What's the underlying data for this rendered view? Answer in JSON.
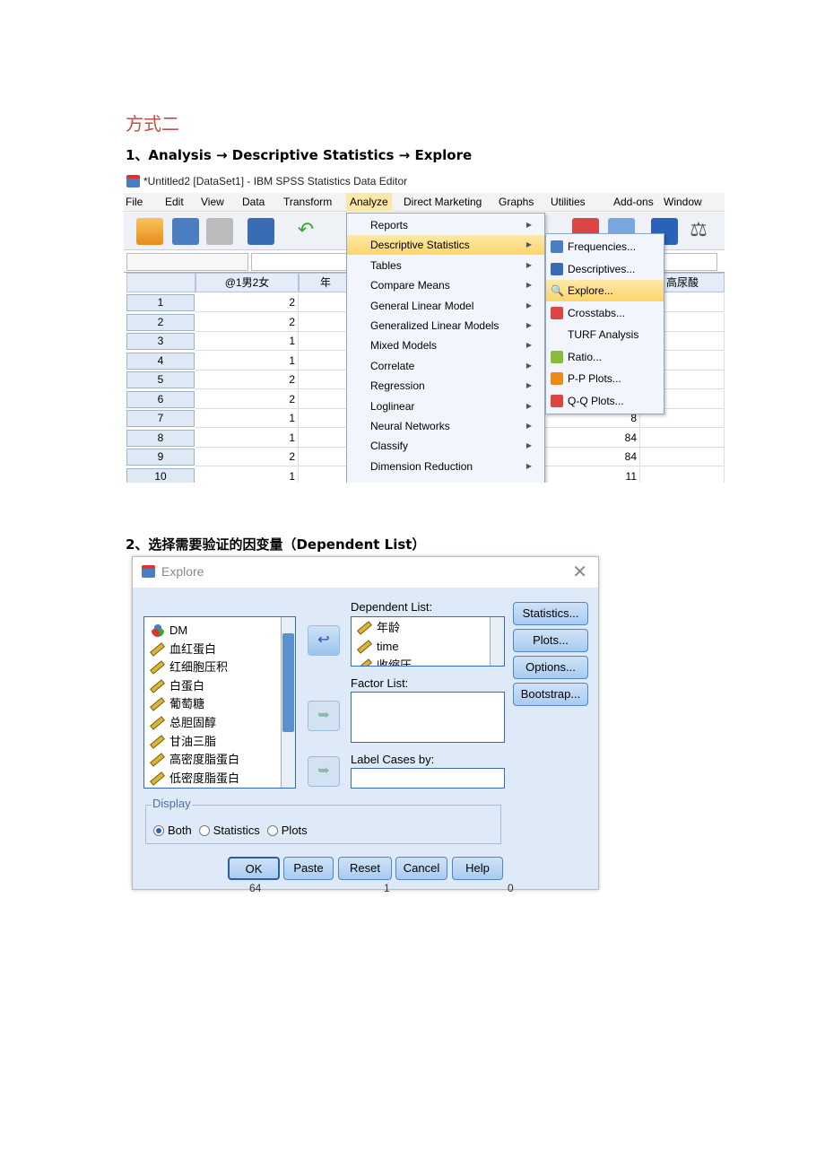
{
  "heading": "方式二",
  "step1": "1、Analysis → Descriptive Statistics → Explore",
  "step2": "2、选择需要验证的因变量（Dependent List）",
  "spss": {
    "title": "*Untitled2 [DataSet1] - IBM SPSS Statistics Data Editor",
    "menubar": [
      "File",
      "Edit",
      "View",
      "Data",
      "Transform",
      "Analyze",
      "Direct Marketing",
      "Graphs",
      "Utilities",
      "Add-ons",
      "Window"
    ],
    "active_menu": "Analyze",
    "columns": [
      "@1男2女",
      "年",
      "高尿酸"
    ],
    "rows": [
      {
        "n": "1",
        "c1": "2",
        "c3": ""
      },
      {
        "n": "2",
        "c1": "2",
        "c3": ""
      },
      {
        "n": "3",
        "c1": "1",
        "c3": ""
      },
      {
        "n": "4",
        "c1": "1",
        "c3": ""
      },
      {
        "n": "5",
        "c1": "2",
        "c3": ""
      },
      {
        "n": "6",
        "c1": "2",
        "c3": ""
      },
      {
        "n": "7",
        "c1": "1",
        "c3": "8"
      },
      {
        "n": "8",
        "c1": "1",
        "c3": "84"
      },
      {
        "n": "9",
        "c1": "2",
        "c3": "84"
      },
      {
        "n": "10",
        "c1": "1",
        "c3": "11"
      }
    ],
    "analyze_menu": [
      "Reports",
      "Descriptive Statistics",
      "Tables",
      "Compare Means",
      "General Linear Model",
      "Generalized Linear Models",
      "Mixed Models",
      "Correlate",
      "Regression",
      "Loglinear",
      "Neural Networks",
      "Classify",
      "Dimension Reduction"
    ],
    "selected_menu_item": "Descriptive Statistics",
    "submenu": [
      "Frequencies...",
      "Descriptives...",
      "Explore...",
      "Crosstabs...",
      "TURF Analysis",
      "Ratio...",
      "P-P Plots...",
      "Q-Q Plots..."
    ],
    "selected_submenu_item": "Explore..."
  },
  "explore": {
    "title": "Explore",
    "variables": [
      "DM",
      "血红蛋白",
      "红细胞压积",
      "白蛋白",
      "葡萄糖",
      "总胆固醇",
      "甘油三脂",
      "高密度脂蛋白",
      "低密度脂蛋白"
    ],
    "dependent_label": "Dependent List:",
    "dependent": [
      "年龄",
      "time",
      "收缩压"
    ],
    "factor_label": "Factor List:",
    "label_cases": "Label Cases by:",
    "side_buttons": [
      "Statistics...",
      "Plots...",
      "Options...",
      "Bootstrap..."
    ],
    "display_label": "Display",
    "display_options": [
      "Both",
      "Statistics",
      "Plots"
    ],
    "display_selected": "Both",
    "bottom_buttons": [
      "OK",
      "Paste",
      "Reset",
      "Cancel",
      "Help"
    ],
    "below_values": [
      "64",
      "1",
      "0"
    ]
  },
  "colors": {
    "heading": "#c0504d",
    "highlight": "#fbd56a",
    "dialog_bg": "#dfeaf8"
  }
}
